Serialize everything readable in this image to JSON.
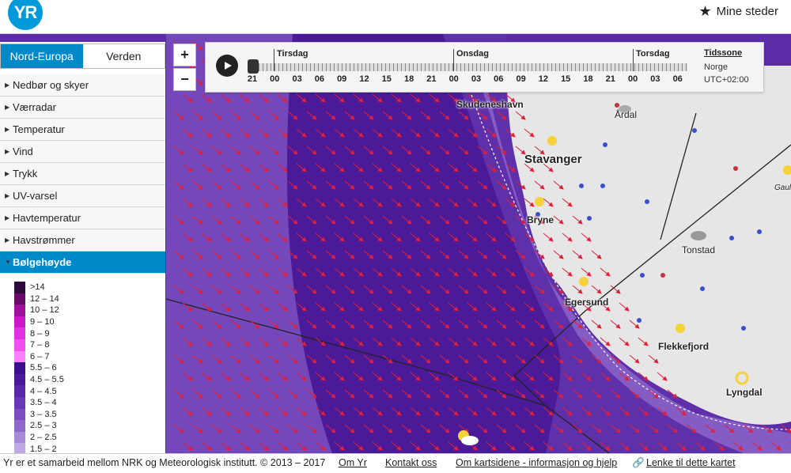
{
  "header": {
    "logo_text": "YR",
    "mine_steder": "Mine steder",
    "star_icon": "star-icon"
  },
  "region_tabs": [
    "Nord-Europa",
    "Verden"
  ],
  "layers": [
    "Nedbør og skyer",
    "Værradar",
    "Temperatur",
    "Vind",
    "Trykk",
    "UV-varsel",
    "Havtemperatur",
    "Havstrømmer",
    "Bølgehøyde"
  ],
  "active_layer": "Bølgehøyde",
  "legend": [
    {
      "label": ">14",
      "color": "#2d0a3a"
    },
    {
      "label": "12 – 14",
      "color": "#6a0a6a"
    },
    {
      "label": "10 – 12",
      "color": "#a0109c"
    },
    {
      "label": "9 – 10",
      "color": "#cc18c8"
    },
    {
      "label": "8 – 9",
      "color": "#e030e0"
    },
    {
      "label": "7 – 8",
      "color": "#f050f0"
    },
    {
      "label": "6 – 7",
      "color": "#ff80ff"
    },
    {
      "label": "5.5 – 6",
      "color": "#3a0f8c"
    },
    {
      "label": "4.5 – 5.5",
      "color": "#4a1a9a"
    },
    {
      "label": "4 – 4.5",
      "color": "#5828a8"
    },
    {
      "label": "3.5 – 4",
      "color": "#6a38b4"
    },
    {
      "label": "3 – 3.5",
      "color": "#7c4cc0"
    },
    {
      "label": "2.5 – 3",
      "color": "#9068cc"
    },
    {
      "label": "2 – 2.5",
      "color": "#a888d8"
    },
    {
      "label": "1.5 – 2",
      "color": "#c0a8e4"
    }
  ],
  "zoom": {
    "in": "+",
    "out": "−"
  },
  "timeline": {
    "days": [
      "Tirsdag",
      "Onsdag",
      "Torsdag"
    ],
    "hours": [
      "21",
      "00",
      "03",
      "06",
      "09",
      "12",
      "15",
      "18",
      "21",
      "00",
      "03",
      "06",
      "09",
      "12",
      "15",
      "18",
      "21",
      "00",
      "03",
      "06"
    ],
    "timezone_title": "Tidssone",
    "timezone_region": "Norge",
    "timezone_offset": "UTC+02:00"
  },
  "places": [
    "Skudeneshavn",
    "Årdal",
    "Stavanger",
    "Bryne",
    "Tonstad",
    "Egersund",
    "Flekkefjord",
    "Lyngdal",
    "Gauli"
  ],
  "footer": {
    "credit": "Yr er et samarbeid mellom NRK og Meteorologisk institutt. © 2013 – 2017",
    "links": [
      "Om Yr",
      "Kontakt oss",
      "Om kartsidene - informasjon og hjelp",
      "Lenke til dette kartet"
    ],
    "link_icon": "chain-link-icon"
  },
  "colors": {
    "accent": "#0089c8",
    "wave_arrow": "#e0203a",
    "land": "#e6e6e6",
    "sea_base": "#5a2aa6"
  }
}
